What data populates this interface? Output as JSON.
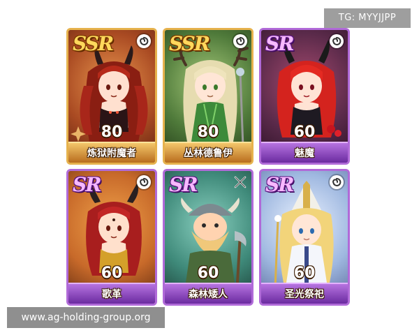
{
  "badge": {
    "text": "TG: MYYJJPP"
  },
  "watermark": {
    "text": "www.ag-holding-group.org"
  },
  "cards": [
    {
      "rarity": "SSR",
      "level": "80",
      "name": "炼狱附魔者",
      "icon": "swirl-icon",
      "frame_color": "#e6b24d",
      "bg_color": "#b5562a"
    },
    {
      "rarity": "SSR",
      "level": "80",
      "name": "丛林德鲁伊",
      "icon": "swirl-icon",
      "frame_color": "#e6b24d",
      "bg_color": "#4f7a3a"
    },
    {
      "rarity": "SR",
      "level": "60",
      "name": "魅魔",
      "icon": "swirl-icon",
      "frame_color": "#b06ad8",
      "bg_color": "#5a2a4a"
    },
    {
      "rarity": "SR",
      "level": "60",
      "name": "歌革",
      "icon": "swirl-icon",
      "frame_color": "#b06ad8",
      "bg_color": "#c86a2a"
    },
    {
      "rarity": "SR",
      "level": "60",
      "name": "森林矮人",
      "icon": "crossed-swords-icon",
      "frame_color": "#b06ad8",
      "bg_color": "#3f8a7a"
    },
    {
      "rarity": "SR",
      "level": "60",
      "name": "圣光祭祀",
      "icon": "swirl-icon",
      "frame_color": "#b06ad8",
      "bg_color": "#9fb8e0"
    }
  ]
}
